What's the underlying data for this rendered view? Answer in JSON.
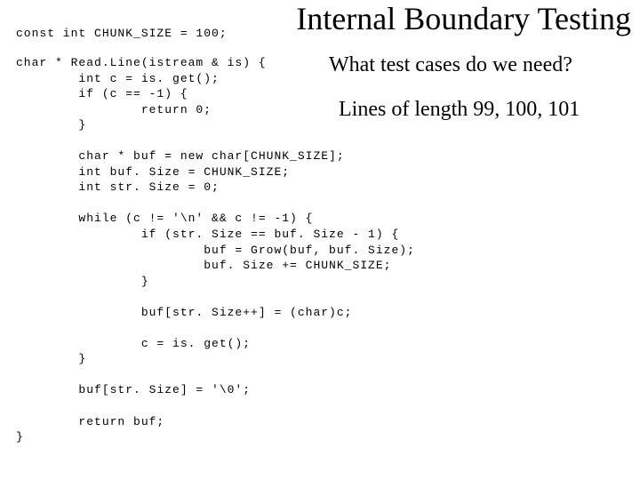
{
  "title": "Internal Boundary Testing",
  "const_line": "const int CHUNK_SIZE = 100;",
  "code": "char * Read.Line(istream & is) {\n        int c = is. get();\n        if (c == -1) {\n                return 0;\n        }\n\n        char * buf = new char[CHUNK_SIZE];\n        int buf. Size = CHUNK_SIZE;\n        int str. Size = 0;\n\n        while (c != '\\n' && c != -1) {\n                if (str. Size == buf. Size - 1) {\n                        buf = Grow(buf, buf. Size);\n                        buf. Size += CHUNK_SIZE;\n                }\n\n                buf[str. Size++] = (char)c;\n\n                c = is. get();\n        }\n\n        buf[str. Size] = '\\0';\n\n        return buf;\n}",
  "question": "What test cases do we need?",
  "answer": "Lines of length 99, 100, 101"
}
